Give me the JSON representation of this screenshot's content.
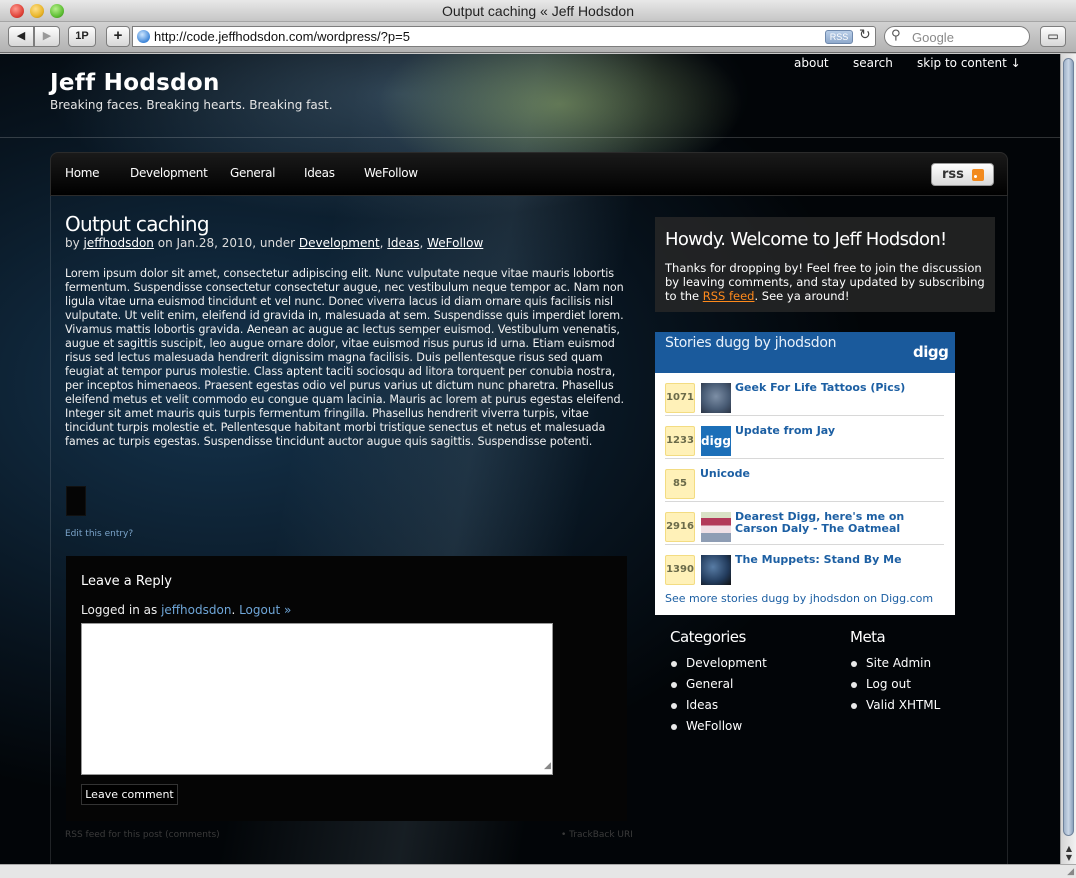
{
  "browser": {
    "window_title": "Output caching « Jeff Hodsdon",
    "url": "http://code.jeffhodsdon.com/wordpress/?p=5",
    "back_icon": "◀",
    "forward_icon": "▶",
    "onepassword_label": "1P",
    "add_bookmark_label": "+",
    "rss_badge": "RSS",
    "search_placeholder": "Google"
  },
  "site": {
    "title": "Jeff Hodsdon",
    "tagline": "Breaking faces. Breaking hearts. Breaking fast.",
    "top_links": [
      "about",
      "search",
      "skip to content ↓"
    ]
  },
  "nav": {
    "items": [
      "Home",
      "Development",
      "General",
      "Ideas",
      "WeFollow"
    ],
    "rss_label": "rss"
  },
  "post": {
    "title": "Output caching",
    "meta_by": "by",
    "author": "jeffhodsdon",
    "meta_on": "on Jan.28, 2010, under",
    "categories": [
      "Development",
      "Ideas",
      "WeFollow"
    ],
    "body": "Lorem ipsum dolor sit amet, consectetur adipiscing elit. Nunc vulputate neque vitae mauris lobortis fermentum. Suspendisse consectetur consectetur augue, nec vestibulum neque tempor ac. Nam non ligula vitae urna euismod tincidunt et vel nunc. Donec viverra lacus id diam ornare quis facilisis nisl vulputate. Ut velit enim, eleifend id gravida in, malesuada at sem. Suspendisse quis imperdiet lorem. Vivamus mattis lobortis gravida. Aenean ac augue ac lectus semper euismod. Vestibulum venenatis, augue et sagittis suscipit, leo augue ornare dolor, vitae euismod risus purus id urna. Etiam euismod risus sed lectus malesuada hendrerit dignissim magna facilisis. Duis pellentesque risus sed quam feugiat at tempor purus molestie. Class aptent taciti sociosqu ad litora torquent per conubia nostra, per inceptos himenaeos. Praesent egestas odio vel purus varius ut dictum nunc pharetra. Phasellus eleifend metus et velit commodo eu congue quam lacinia. Mauris ac lorem at purus egestas eleifend. Integer sit amet mauris quis turpis fermentum fringilla. Phasellus hendrerit viverra turpis, vitae tincidunt turpis molestie et. Pellentesque habitant morbi tristique senectus et netus et malesuada fames ac turpis egestas. Suspendisse tincidunt auctor augue quis sagittis. Suspendisse potenti.",
    "edit_link": "Edit this entry?"
  },
  "reply": {
    "title": "Leave a Reply",
    "logged_in_prefix": "Logged in as",
    "user": "jeffhodsdon",
    "logout": "Logout »",
    "comment_value": "",
    "submit_label": "Leave comment",
    "rss_comments": "RSS feed for this post (comments)",
    "trackback": "• TrackBack URI"
  },
  "welcome": {
    "heading": "Howdy. Welcome to Jeff Hodsdon!",
    "text_before": "Thanks for dropping by! Feel free to join the discussion by leaving comments, and stay updated by subscribing to the",
    "rss_link": "RSS feed",
    "text_after": ". See ya around!"
  },
  "digg": {
    "title": "Stories dugg by jhodsdon",
    "logo": "digg",
    "stories": [
      {
        "count": "1071",
        "title": "Geek For Life Tattoos (Pics)",
        "thumb": "tattoo-thumbnail"
      },
      {
        "count": "1233",
        "title": "Update from Jay",
        "thumb": "digg-logo-thumbnail",
        "thumb_text": "digg"
      },
      {
        "count": "85",
        "title": "Unicode",
        "thumb": ""
      },
      {
        "count": "2916",
        "title": "Dearest Digg, here's me on Carson Daly - The Oatmeal",
        "thumb": "oatmeal-thumbnail"
      },
      {
        "count": "1390",
        "title": "The Muppets: Stand By Me",
        "thumb": "muppets-thumbnail"
      }
    ],
    "more": "See more stories dugg by jhodsdon on Digg.com"
  },
  "sidebar": {
    "categories_title": "Categories",
    "categories": [
      "Development",
      "General",
      "Ideas",
      "WeFollow"
    ],
    "meta_title": "Meta",
    "meta": [
      "Site Admin",
      "Log out",
      "Valid XHTML"
    ]
  }
}
